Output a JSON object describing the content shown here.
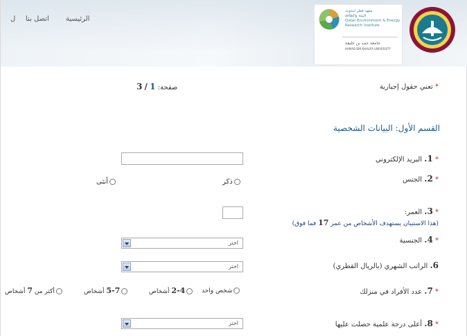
{
  "header": {
    "nav": {
      "home": "الرئيسية",
      "contact": "اتصل بنا",
      "more": "ل"
    },
    "institute_lines": [
      "معهد قطر لبحوث",
      "البيئة والطاقة",
      "Qatar Environment & Energy",
      "Research Institute"
    ],
    "university_lines": [
      "جامعة حمد بن خليفة",
      "HAMAD BIN KHALIFA UNIVERSITY"
    ]
  },
  "form": {
    "required_note": "تعني حقول إجبارية",
    "page_label": "صفحة:",
    "page_current": "1",
    "page_sep": "/",
    "page_total": "3",
    "section_title": "القسم الأول: البيانات الشخصية",
    "q1": {
      "num": "1.",
      "label": "البريد الإلكتروني"
    },
    "q2": {
      "num": "2.",
      "label": "الجنس",
      "options": [
        "ذكر",
        "أنثى"
      ]
    },
    "q3": {
      "num": "3.",
      "label": "العمر:",
      "note_pre": "(هذا الاستبيان يستهدف الأشخاص من عمر",
      "note_age": "17",
      "note_post": "فما فوق)"
    },
    "q4": {
      "num": "4.",
      "label": "الجنسية",
      "select_value": "اختر"
    },
    "q6": {
      "num": "6.",
      "label": "الراتب الشهري (بالريال القطري)",
      "select_value": "اختر"
    },
    "q7": {
      "num": "7.",
      "label": "عدد الأفراد في منزلك",
      "options": [
        {
          "text": "شخص واحد"
        },
        {
          "range": "2-4",
          "text": "أشخاص"
        },
        {
          "range": "5-7",
          "text": "أشخاص"
        },
        {
          "prefix": "أكثر من",
          "range": "7",
          "text": "أشخاص"
        }
      ]
    },
    "q8": {
      "num": "8.",
      "label": "أعلى درجة علمية حصلت عليها",
      "select_value": "اختر"
    },
    "required_marker": "*"
  }
}
